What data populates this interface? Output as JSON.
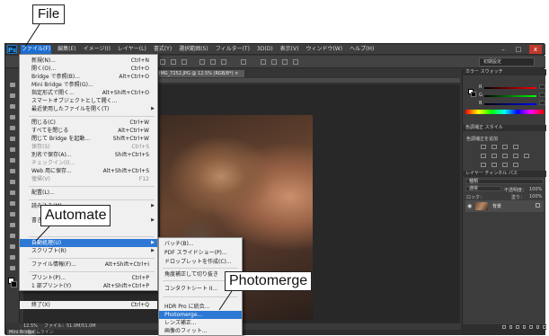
{
  "menubar": {
    "logo": "Ps",
    "items": [
      "ファイル(F)",
      "編集(E)",
      "イメージ(I)",
      "レイヤー(L)",
      "書式(Y)",
      "選択範囲(S)",
      "フィルター(T)",
      "3D(D)",
      "表示(V)",
      "ウィンドウ(W)",
      "ヘルプ(H)"
    ],
    "window_controls": [
      "–",
      "□",
      "x"
    ]
  },
  "options_bar": {
    "workspace": "初期設定"
  },
  "document_tab": {
    "title": "IMG_7252.JPG @ 12.5% (RGB/8*) ×"
  },
  "status_bar": {
    "zoom": "12.5%",
    "doc_size": "ファイル：51.0M/51.0M"
  },
  "bottom_bar": {
    "mini_bridge": "Mini Bridge",
    "timeline": "タイムライン"
  },
  "panels": {
    "color_tabs": "カラー  スウォッチ",
    "rgb_labels": [
      "R",
      "G",
      "B"
    ],
    "adjust_tabs": "色調補正  スタイル",
    "adjust_label": "色調補正を追加",
    "layers_tabs": "レイヤー  チャンネル  パス",
    "layer_kind": "種類",
    "blend_mode": "通常",
    "opacity_label": "不透明度：",
    "opacity": "100%",
    "lock_label": "ロック：",
    "fill_label": "塗り：",
    "fill": "100%",
    "layer_name": "背景"
  },
  "file_menu": {
    "items": [
      {
        "label": "新規(N)...",
        "shortcut": "Ctrl+N"
      },
      {
        "label": "開く(O)...",
        "shortcut": "Ctrl+O"
      },
      {
        "label": "Bridge で参照(B)...",
        "shortcut": "Alt+Ctrl+O"
      },
      {
        "label": "Mini Bridge で参照(G)...",
        "shortcut": ""
      },
      {
        "label": "指定形式で開く...",
        "shortcut": "Alt+Shift+Ctrl+O"
      },
      {
        "label": "スマートオブジェクトとして開く...",
        "shortcut": ""
      },
      {
        "label": "最近使用したファイルを開く(T)",
        "shortcut": ""
      },
      {
        "label": "閉じる(C)",
        "shortcut": "Ctrl+W"
      },
      {
        "label": "すべてを閉じる",
        "shortcut": "Alt+Ctrl+W"
      },
      {
        "label": "閉じて Bridge を起動...",
        "shortcut": "Shift+Ctrl+W"
      },
      {
        "label": "保存(S)",
        "shortcut": "Ctrl+S"
      },
      {
        "label": "別名で保存(A)...",
        "shortcut": "Shift+Ctrl+S"
      },
      {
        "label": "チェックイン(I)...",
        "shortcut": ""
      },
      {
        "label": "Web 用に保存...",
        "shortcut": "Alt+Shift+Ctrl+S"
      },
      {
        "label": "復帰(V)",
        "shortcut": "F12"
      },
      {
        "label": "配置(L)...",
        "shortcut": ""
      },
      {
        "label": "読み込み(M)",
        "shortcut": ""
      },
      {
        "label": "書き出し(E)",
        "shortcut": ""
      },
      {
        "label": "自動処理(U)",
        "shortcut": ""
      },
      {
        "label": "スクリプト(R)",
        "shortcut": ""
      },
      {
        "label": "ファイル情報(F)...",
        "shortcut": "Alt+Shift+Ctrl+I"
      },
      {
        "label": "プリント(P)...",
        "shortcut": "Ctrl+P"
      },
      {
        "label": "1 部プリント(Y)",
        "shortcut": "Alt+Shift+Ctrl+P"
      },
      {
        "label": "終了(X)",
        "shortcut": "Ctrl+Q"
      }
    ]
  },
  "automate_submenu": {
    "items": [
      "バッチ(B)...",
      "PDF スライドショー(P)...",
      "ドロップレットを作成(C)...",
      "角度補正して切り抜き",
      "コンタクトシート II...",
      "HDR Pro に統合...",
      "Photomerge...",
      "レンズ補正...",
      "画像のフィット..."
    ]
  },
  "callouts": {
    "file": "File",
    "automate": "Automate",
    "photomerge": "Photomerge"
  }
}
